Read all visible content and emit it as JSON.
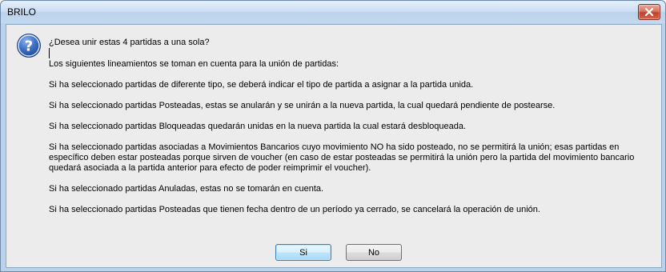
{
  "window": {
    "title": "BRILO",
    "close_icon": "close-icon"
  },
  "dialog": {
    "icon": "question-icon",
    "question": "¿Desea unir estas 4 partidas a una sola?",
    "paragraphs": [
      "Los siguientes lineamientos se toman en cuenta para la unión de partidas:",
      "Si ha seleccionado partidas de diferente tipo, se deberá indicar el tipo de partida a asignar a la partida unida.",
      "Si ha seleccionado partidas Posteadas, estas se anularán y se unirán a la nueva partida, la cual quedará pendiente de postearse.",
      "Si ha seleccionado partidas Bloqueadas quedarán unidas en la nueva partida la cual estará desbloqueada.",
      "Si ha seleccionado partidas asociadas a Movimientos Bancarios cuyo movimiento NO ha sido posteado, no se permitirá la unión; esas partidas en específico deben estar posteadas porque sirven de voucher (en caso de estar posteadas se permitirá la unión pero la partida del movimiento bancario quedará asociada a la partida anterior para efecto de poder reimprimir el voucher).",
      "Si ha seleccionado partidas Anuladas, estas no se tomarán en cuenta.",
      "Si ha seleccionado partidas Posteadas que tienen fecha dentro de un período ya cerrado, se cancelará la operación de unión."
    ],
    "yes_label": "Si",
    "no_label": "No"
  },
  "colors": {
    "titlebar": "#c4d9ef",
    "client_background": "#ececec",
    "close_button": "#c0402a",
    "icon_blue": "#2a5aa8"
  }
}
